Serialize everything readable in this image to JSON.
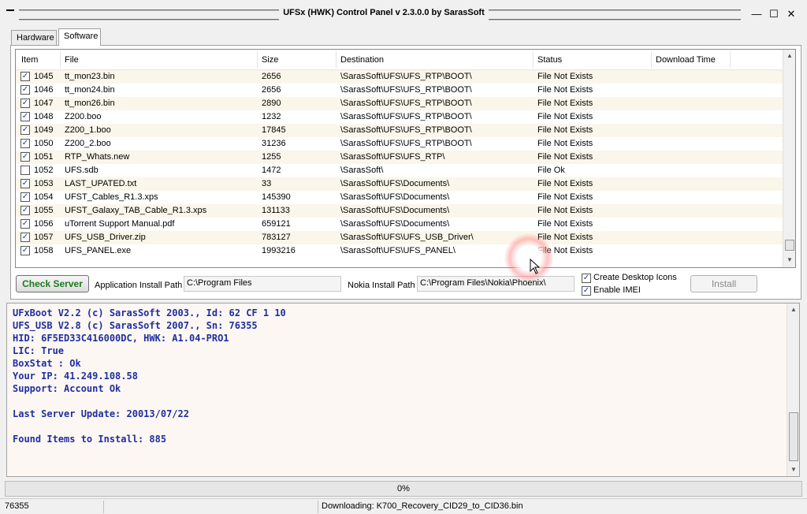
{
  "window": {
    "title": "UFSx (HWK) Control Panel v 2.3.0.0 by SarasSoft",
    "minimize_icon": "minimize-icon",
    "maximize_icon": "maximize-icon",
    "close_icon": "close-icon"
  },
  "tabs": [
    {
      "label": "Hardware",
      "active": false
    },
    {
      "label": "Software",
      "active": true
    }
  ],
  "grid": {
    "columns": [
      "Item",
      "File",
      "Size",
      "Destination",
      "Status",
      "Download Time"
    ],
    "rows": [
      {
        "checked": true,
        "item": "1045",
        "file": "tt_mon23.bin",
        "size": "2656",
        "destination": "\\SarasSoft\\UFS\\UFS_RTP\\BOOT\\",
        "status": "File Not Exists",
        "download_time": ""
      },
      {
        "checked": true,
        "item": "1046",
        "file": "tt_mon24.bin",
        "size": "2656",
        "destination": "\\SarasSoft\\UFS\\UFS_RTP\\BOOT\\",
        "status": "File Not Exists",
        "download_time": ""
      },
      {
        "checked": true,
        "item": "1047",
        "file": "tt_mon26.bin",
        "size": "2890",
        "destination": "\\SarasSoft\\UFS\\UFS_RTP\\BOOT\\",
        "status": "File Not Exists",
        "download_time": ""
      },
      {
        "checked": true,
        "item": "1048",
        "file": "Z200.boo",
        "size": "1232",
        "destination": "\\SarasSoft\\UFS\\UFS_RTP\\BOOT\\",
        "status": "File Not Exists",
        "download_time": ""
      },
      {
        "checked": true,
        "item": "1049",
        "file": "Z200_1.boo",
        "size": "17845",
        "destination": "\\SarasSoft\\UFS\\UFS_RTP\\BOOT\\",
        "status": "File Not Exists",
        "download_time": ""
      },
      {
        "checked": true,
        "item": "1050",
        "file": "Z200_2.boo",
        "size": "31236",
        "destination": "\\SarasSoft\\UFS\\UFS_RTP\\BOOT\\",
        "status": "File Not Exists",
        "download_time": ""
      },
      {
        "checked": true,
        "item": "1051",
        "file": "RTP_Whats.new",
        "size": "1255",
        "destination": "\\SarasSoft\\UFS\\UFS_RTP\\",
        "status": "File Not Exists",
        "download_time": ""
      },
      {
        "checked": false,
        "item": "1052",
        "file": "UFS.sdb",
        "size": "1472",
        "destination": "\\SarasSoft\\",
        "status": "File Ok",
        "download_time": ""
      },
      {
        "checked": true,
        "item": "1053",
        "file": "LAST_UPATED.txt",
        "size": "33",
        "destination": "\\SarasSoft\\UFS\\Documents\\",
        "status": "File Not Exists",
        "download_time": ""
      },
      {
        "checked": true,
        "item": "1054",
        "file": "UFST_Cables_R1.3.xps",
        "size": "145390",
        "destination": "\\SarasSoft\\UFS\\Documents\\",
        "status": "File Not Exists",
        "download_time": ""
      },
      {
        "checked": true,
        "item": "1055",
        "file": "UFST_Galaxy_TAB_Cable_R1.3.xps",
        "size": "131133",
        "destination": "\\SarasSoft\\UFS\\Documents\\",
        "status": "File Not Exists",
        "download_time": ""
      },
      {
        "checked": true,
        "item": "1056",
        "file": "uTorrent Support Manual.pdf",
        "size": "659121",
        "destination": "\\SarasSoft\\UFS\\Documents\\",
        "status": "File Not Exists",
        "download_time": ""
      },
      {
        "checked": true,
        "item": "1057",
        "file": "UFS_USB_Driver.zip",
        "size": "783127",
        "destination": "\\SarasSoft\\UFS\\UFS_USB_Driver\\",
        "status": "File Not Exists",
        "download_time": ""
      },
      {
        "checked": true,
        "item": "1058",
        "file": "UFS_PANEL.exe",
        "size": "1993216",
        "destination": "\\SarasSoft\\UFS\\UFS_PANEL\\",
        "status": "File Not Exists",
        "download_time": ""
      }
    ]
  },
  "controls": {
    "check_server_label": "Check Server",
    "app_install_path_label": "Application Install Path",
    "app_install_path_value": "C:\\Program Files",
    "nokia_install_path_label": "Nokia Install Path",
    "nokia_install_path_value": "C:\\Program Files\\Nokia\\Phoenix\\",
    "create_desktop_icons_label": "Create Desktop Icons",
    "create_desktop_icons_checked": true,
    "enable_imei_label": "Enable IMEI",
    "enable_imei_checked": true,
    "install_label": "Install"
  },
  "log": {
    "lines": [
      "UFxBoot V2.2 (c) SarasSoft 2003., Id: 62 CF 1 10",
      "UFS_USB V2.8 (c) SarasSoft 2007., Sn: 76355",
      "HID: 6F5ED33C416000DC, HWK: A1.04-PRO1",
      "LIC: True",
      "BoxStat : Ok",
      "Your IP: 41.249.108.58",
      "Support: Account Ok",
      "",
      "Last Server Update: 20013/07/22",
      "",
      "Found Items to Install: 885"
    ]
  },
  "progress": {
    "percent_text": "0%",
    "value": 0
  },
  "statusbar": {
    "serial": "76355",
    "empty": "",
    "downloading": "Downloading: K700_Recovery_CID29_to_CID36.bin"
  }
}
